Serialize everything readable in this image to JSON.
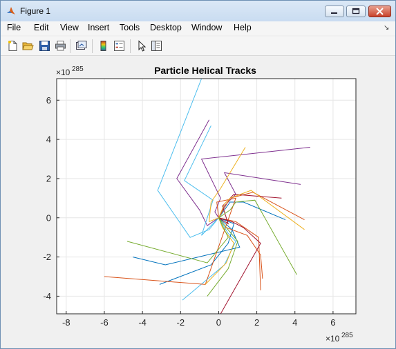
{
  "window": {
    "title": "Figure 1"
  },
  "menu": [
    "File",
    "Edit",
    "View",
    "Insert",
    "Tools",
    "Desktop",
    "Window",
    "Help"
  ],
  "toolbar_icons": [
    "new-figure-icon",
    "open-file-icon",
    "save-icon",
    "print-icon",
    "link-plot-icon",
    "colorbar-icon",
    "legend-icon",
    "pointer-icon",
    "property-editor-icon"
  ],
  "chart_data": {
    "type": "line",
    "title": "Particle Helical Tracks",
    "x_exponent_label": "×10",
    "x_exponent": "285",
    "y_exponent_label": "×10",
    "y_exponent": "285",
    "xlim": [
      -8.5,
      7.2
    ],
    "ylim": [
      -4.9,
      7.1
    ],
    "xticks": [
      "-8",
      "-6",
      "-4",
      "-2",
      "0",
      "2",
      "4",
      "6"
    ],
    "xtick_values": [
      -8,
      -6,
      -4,
      -2,
      0,
      2,
      4,
      6
    ],
    "yticks": [
      "-4",
      "-2",
      "0",
      "2",
      "4",
      "6"
    ],
    "ytick_values": [
      -4,
      -2,
      0,
      2,
      4,
      6
    ],
    "grid": true,
    "series": [
      {
        "color": "#7E2F8E",
        "x": [
          0,
          -0.2,
          0.1,
          -0.9,
          4.8
        ],
        "y": [
          0,
          0.3,
          1.0,
          3.0,
          3.6
        ]
      },
      {
        "color": "#7E2F8E",
        "x": [
          0,
          -0.6,
          -1.0,
          -2.2,
          -0.5
        ],
        "y": [
          0,
          -0.4,
          0.4,
          2.0,
          5.0
        ]
      },
      {
        "color": "#7E2F8E",
        "x": [
          0,
          0.3,
          0.9,
          0.3,
          4.3
        ],
        "y": [
          0,
          0.6,
          1.2,
          2.3,
          1.7
        ]
      },
      {
        "color": "#4DBEEE",
        "x": [
          0,
          -0.5,
          -1.5,
          -3.2,
          -0.9
        ],
        "y": [
          0,
          -0.6,
          -1.0,
          1.4,
          7.1
        ]
      },
      {
        "color": "#4DBEEE",
        "x": [
          0,
          -0.9,
          -0.3,
          -1.8,
          -0.4
        ],
        "y": [
          0,
          -0.9,
          0.9,
          1.9,
          4.7
        ]
      },
      {
        "color": "#4DBEEE",
        "x": [
          0,
          0.5,
          0.9,
          0.3,
          -1.9
        ],
        "y": [
          0,
          -0.8,
          -1.2,
          -2.4,
          -4.2
        ]
      },
      {
        "color": "#0072BD",
        "x": [
          0,
          0.7,
          1.1,
          -2.8,
          -4.5
        ],
        "y": [
          0,
          -0.6,
          -1.5,
          -2.4,
          -2.0
        ]
      },
      {
        "color": "#0072BD",
        "x": [
          0,
          0.8,
          0.5,
          -0.4,
          -3.1
        ],
        "y": [
          0,
          -0.3,
          -1.3,
          -2.4,
          -3.4
        ]
      },
      {
        "color": "#0072BD",
        "x": [
          0,
          0.6,
          1.3,
          3.5
        ],
        "y": [
          0,
          0.8,
          0.8,
          -0.1
        ]
      },
      {
        "color": "#D95319",
        "x": [
          0,
          0.4,
          1.5,
          2.2,
          2.3
        ],
        "y": [
          0,
          -0.5,
          -0.9,
          -1.9,
          -3.1
        ]
      },
      {
        "color": "#D95319",
        "x": [
          0,
          0.9,
          2.1,
          2.2
        ],
        "y": [
          0,
          -0.2,
          -1.0,
          -3.7
        ]
      },
      {
        "color": "#D95319",
        "x": [
          0,
          0.6,
          1.8,
          4.5
        ],
        "y": [
          0,
          1.0,
          1.3,
          -0.1
        ]
      },
      {
        "color": "#D95319",
        "x": [
          0,
          -0.1,
          0.9,
          -0.7,
          -6.0
        ],
        "y": [
          0,
          0.8,
          1.0,
          -3.4,
          -3.0
        ]
      },
      {
        "color": "#A2142F",
        "x": [
          0,
          0.5,
          0.2,
          0.8,
          3.3
        ],
        "y": [
          0,
          -0.3,
          0.6,
          1.2,
          1.0
        ]
      },
      {
        "color": "#A2142F",
        "x": [
          0,
          0.7,
          1.3,
          2.2,
          0.1
        ],
        "y": [
          0,
          -0.2,
          -0.5,
          -1.3,
          -4.9
        ]
      },
      {
        "color": "#EDB120",
        "x": [
          0,
          0.2,
          0.8,
          0.4,
          -0.7
        ],
        "y": [
          0,
          -0.5,
          -1.3,
          -2.3,
          -3.4
        ]
      },
      {
        "color": "#EDB120",
        "x": [
          0,
          -0.5,
          -0.4,
          0.1,
          1.4
        ],
        "y": [
          0,
          -0.2,
          0.8,
          1.5,
          3.6
        ]
      },
      {
        "color": "#EDB120",
        "x": [
          0,
          0.3,
          0.6,
          1.7,
          4.5
        ],
        "y": [
          0,
          0.7,
          1.0,
          1.4,
          -0.6
        ]
      },
      {
        "color": "#77AC30",
        "x": [
          0,
          0.4,
          1.0,
          0.5,
          -0.6
        ],
        "y": [
          0,
          -0.5,
          -1.2,
          -2.6,
          -4.0
        ]
      },
      {
        "color": "#77AC30",
        "x": [
          0,
          0.6,
          0.9,
          1.9,
          4.1
        ],
        "y": [
          0,
          0.4,
          0.8,
          0.9,
          -2.9
        ]
      },
      {
        "color": "#77AC30",
        "x": [
          0,
          0.2,
          0.5,
          -0.6,
          -4.8
        ],
        "y": [
          0,
          -0.4,
          -1.0,
          -2.3,
          -1.2
        ]
      }
    ]
  }
}
